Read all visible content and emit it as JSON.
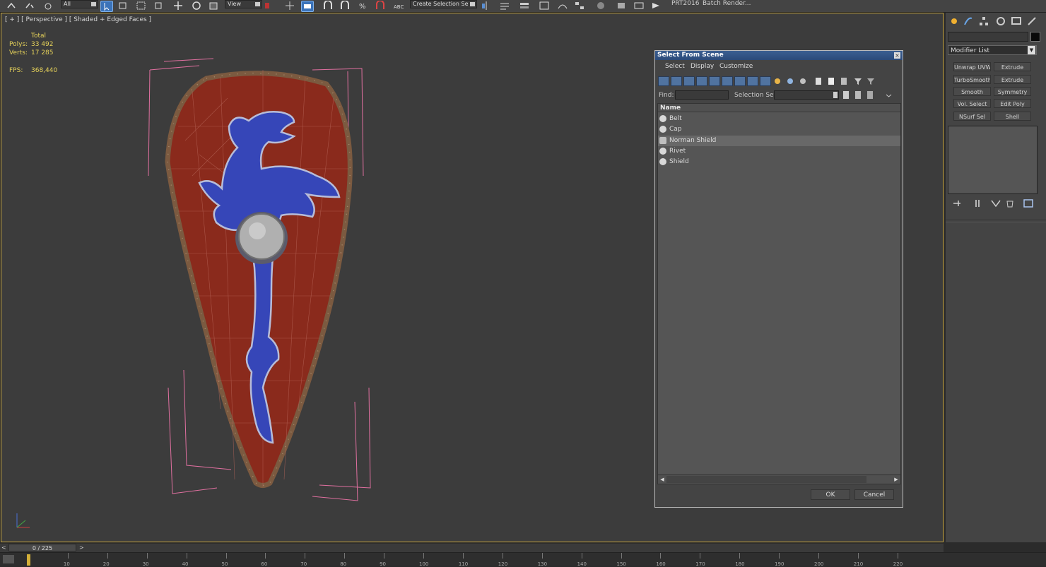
{
  "toolbar": {
    "dropdown_all": "All",
    "dropdown_view": "View",
    "selection_set_field": "Create Selection Se",
    "prt_label": "PRT2016",
    "batch_render_label": "Batch Render..."
  },
  "viewport": {
    "label": "[ + ] [ Perspective ] [ Shaded + Edged Faces ]",
    "stats": {
      "total_label": "Total",
      "polys_label": "Polys:",
      "polys_value": "33 492",
      "verts_label": "Verts:",
      "verts_value": "17 285",
      "fps_label": "FPS:",
      "fps_value": "368,440"
    }
  },
  "command_panel": {
    "modifier_list_label": "Modifier List",
    "modifier_buttons": [
      "Unwrap UVW",
      "Extrude",
      "TurboSmooth",
      "Extrude",
      "Smooth",
      "Symmetry",
      "Vol. Select",
      "Edit Poly",
      "NSurf Sel",
      "Shell"
    ]
  },
  "dialog": {
    "title": "Select From Scene",
    "menu": [
      "Select",
      "Display",
      "Customize"
    ],
    "find_label": "Find:",
    "selection_set_label": "Selection Set:",
    "list_header": "Name",
    "items": [
      {
        "name": "Belt",
        "selected": false
      },
      {
        "name": "Cap",
        "selected": false
      },
      {
        "name": "Norman Shield",
        "selected": true
      },
      {
        "name": "Rivet",
        "selected": false
      },
      {
        "name": "Shield",
        "selected": false
      }
    ],
    "ok_label": "OK",
    "cancel_label": "Cancel"
  },
  "timeline": {
    "frame_indicator": "0 / 225",
    "ticks": [
      "10",
      "20",
      "30",
      "40",
      "50",
      "60",
      "70",
      "80",
      "90",
      "100",
      "110",
      "120",
      "130",
      "140",
      "150",
      "160",
      "170",
      "180",
      "190",
      "200",
      "210",
      "220"
    ]
  },
  "colors": {
    "viewport_bg": "#3c3c3c",
    "viewport_border": "#c9a73f",
    "stats_text": "#e6d25a",
    "shield_red": "#8a2a1c",
    "shield_blue": "#3646b8",
    "bounding_box": "#e070a0",
    "title_bar": "#2b4a79"
  }
}
